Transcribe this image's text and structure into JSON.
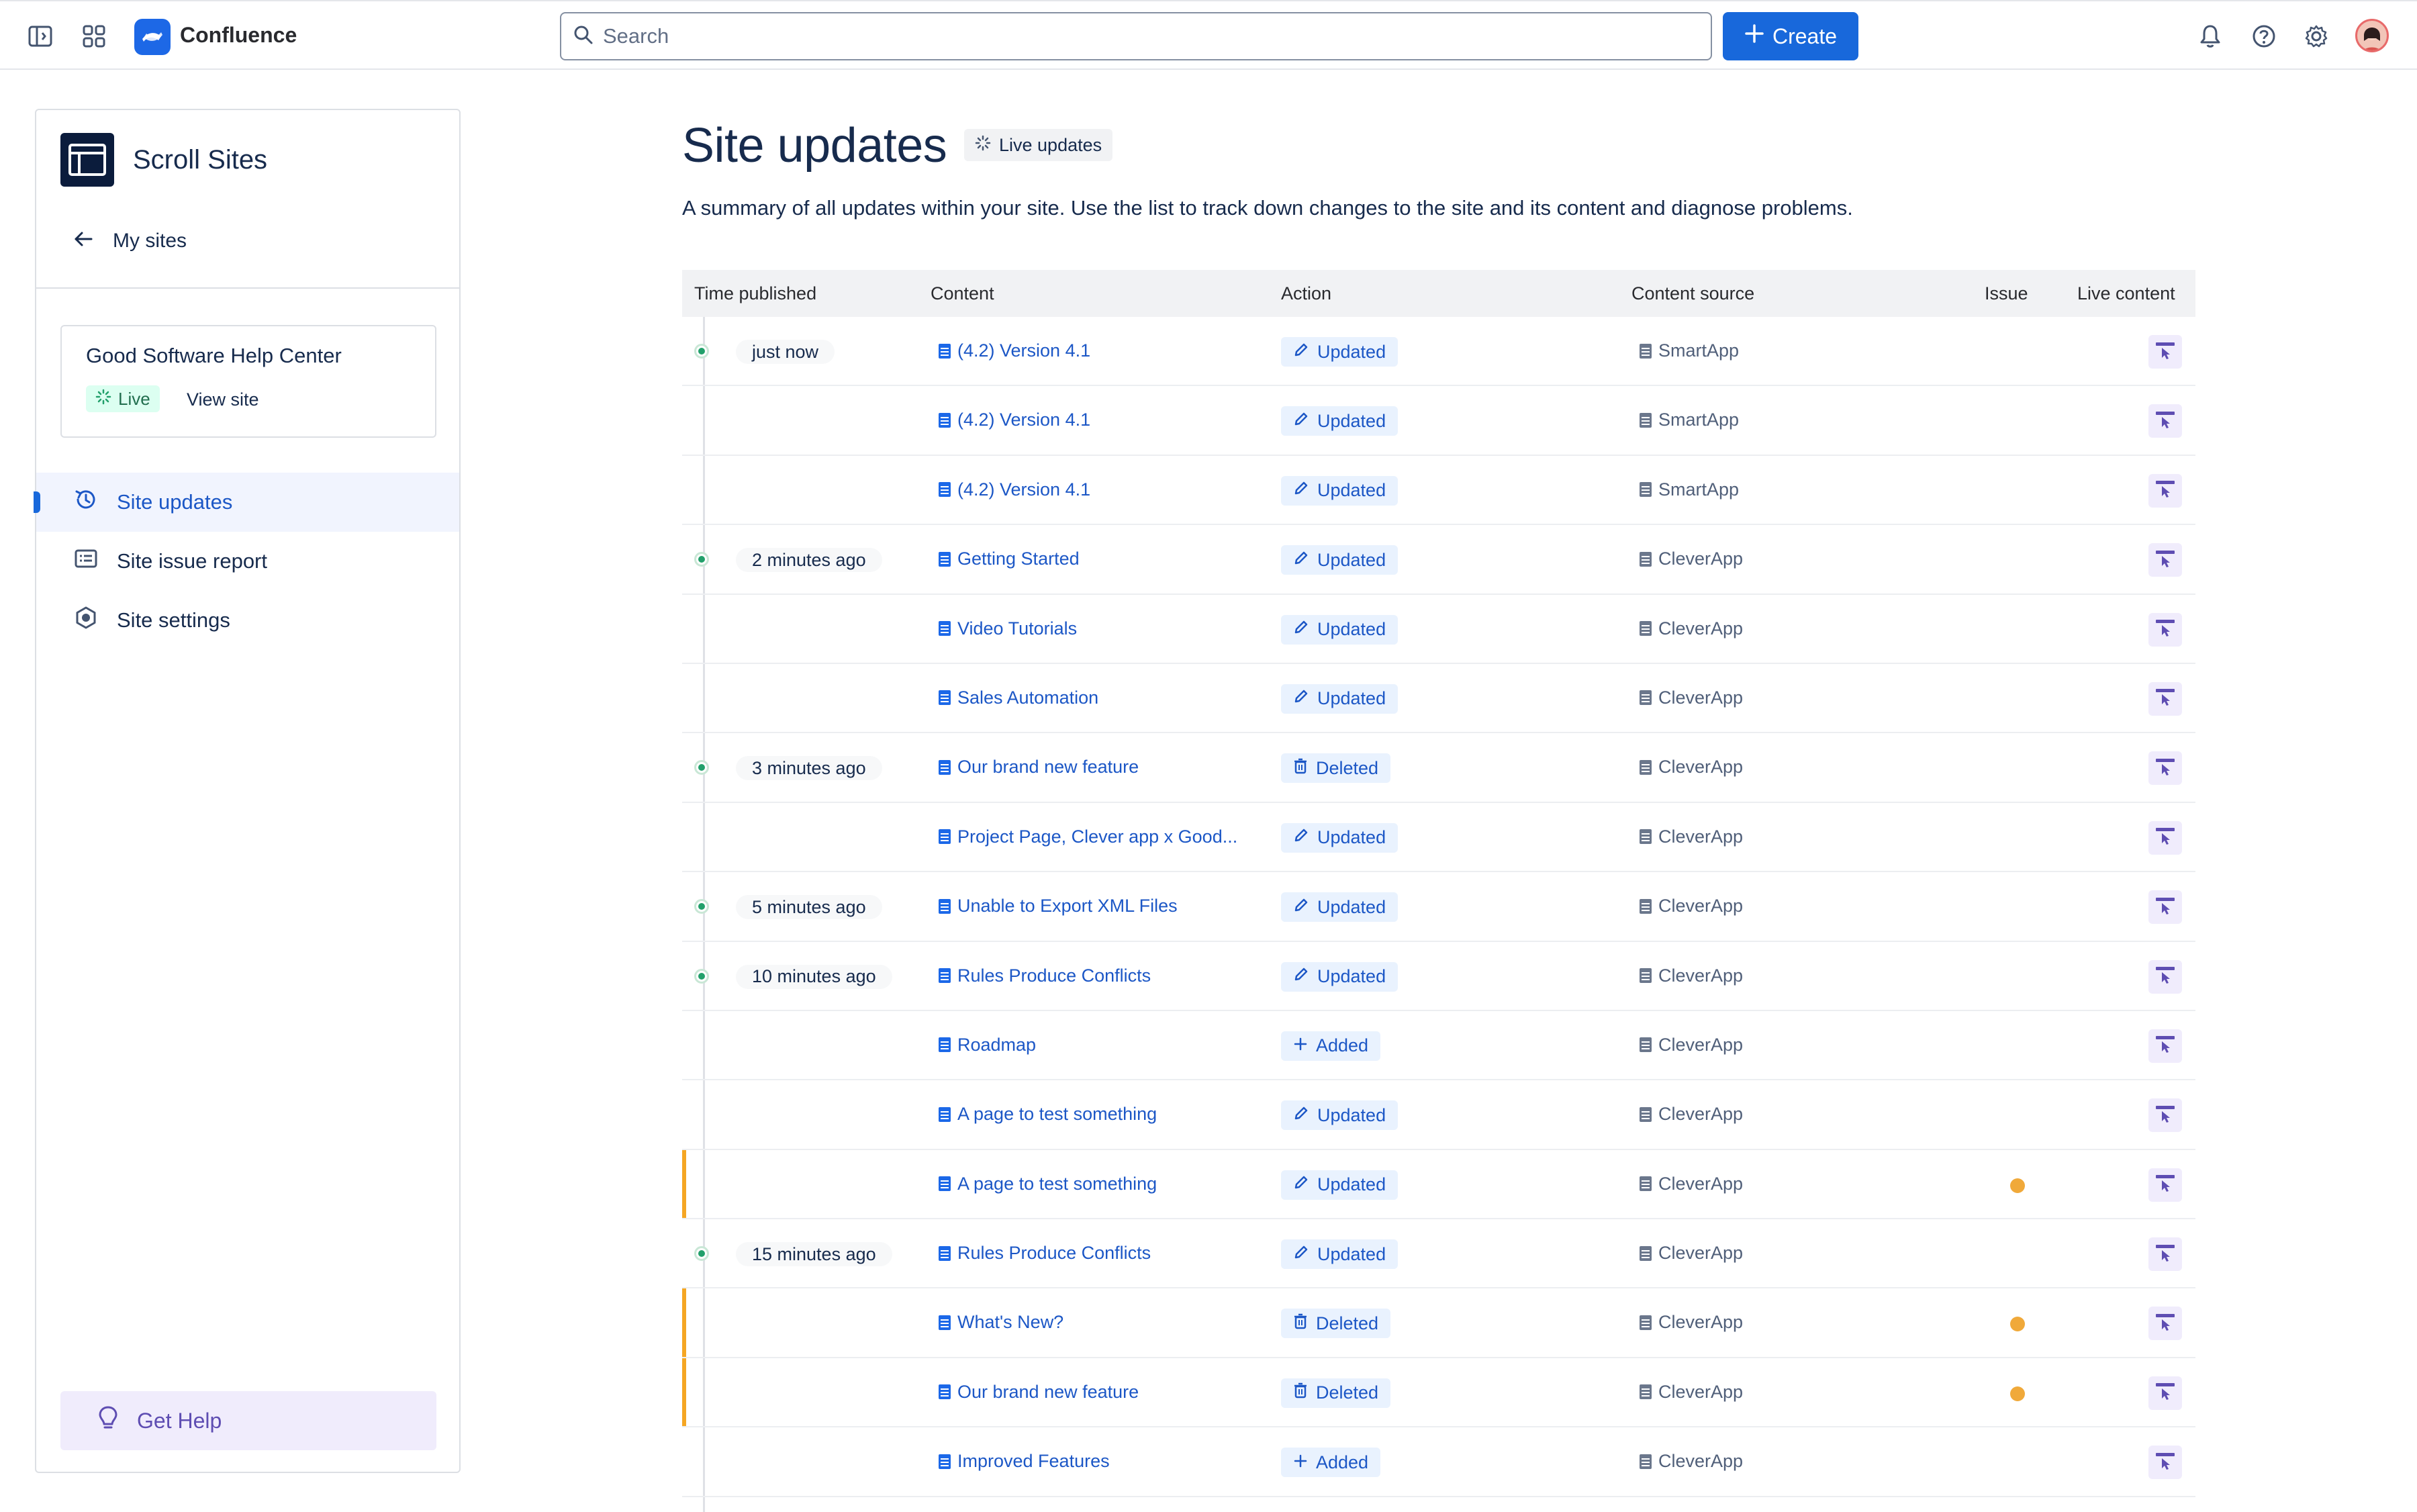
{
  "topnav": {
    "brand": "Confluence",
    "search_placeholder": "Search",
    "create_label": "Create",
    "icons": [
      "sidebar-toggle-icon",
      "app-switcher-icon",
      "confluence-logo-icon",
      "search-icon",
      "plus-icon",
      "bell-icon",
      "help-icon",
      "gear-icon"
    ]
  },
  "sidebar": {
    "app_name": "Scroll Sites",
    "back_label": "My sites",
    "site_card": {
      "name": "Good Software Help Center",
      "status": "Live",
      "view_site": "View site"
    },
    "nav": [
      {
        "label": "Site updates",
        "icon": "history-icon",
        "active": true
      },
      {
        "label": "Site issue report",
        "icon": "report-icon",
        "active": false
      },
      {
        "label": "Site settings",
        "icon": "settings-hex-icon",
        "active": false
      }
    ],
    "get_help": "Get Help"
  },
  "main": {
    "title": "Site updates",
    "live_badge": "Live updates",
    "description": "A summary of all updates within your site. Use the list to track down changes to the site and its content and diagnose problems.",
    "columns": [
      "Time published",
      "Content",
      "Action",
      "Content source",
      "Issue",
      "Live content"
    ],
    "rows": [
      {
        "time": "just now",
        "content": "(4.2) Version 4.1",
        "action": "Updated",
        "source": "SmartApp",
        "issue": false
      },
      {
        "time": "",
        "content": "(4.2) Version 4.1",
        "action": "Updated",
        "source": "SmartApp",
        "issue": false
      },
      {
        "time": "",
        "content": "(4.2) Version 4.1",
        "action": "Updated",
        "source": "SmartApp",
        "issue": false
      },
      {
        "time": "2 minutes ago",
        "content": "Getting Started",
        "action": "Updated",
        "source": "CleverApp",
        "issue": false
      },
      {
        "time": "",
        "content": "Video Tutorials",
        "action": "Updated",
        "source": "CleverApp",
        "issue": false
      },
      {
        "time": "",
        "content": "Sales Automation",
        "action": "Updated",
        "source": "CleverApp",
        "issue": false
      },
      {
        "time": "3 minutes ago",
        "content": "Our brand new feature",
        "action": "Deleted",
        "source": "CleverApp",
        "issue": false
      },
      {
        "time": "",
        "content": "Project Page, Clever app x Good...",
        "action": "Updated",
        "source": "CleverApp",
        "issue": false
      },
      {
        "time": "5 minutes ago",
        "content": "Unable to Export XML Files",
        "action": "Updated",
        "source": "CleverApp",
        "issue": false
      },
      {
        "time": "10 minutes ago",
        "content": "Rules Produce Conflicts",
        "action": "Updated",
        "source": "CleverApp",
        "issue": false
      },
      {
        "time": "",
        "content": "Roadmap",
        "action": "Added",
        "source": "CleverApp",
        "issue": false
      },
      {
        "time": "",
        "content": "A page to test something",
        "action": "Updated",
        "source": "CleverApp",
        "issue": false
      },
      {
        "time": "",
        "content": "A page to test something",
        "action": "Updated",
        "source": "CleverApp",
        "issue": true
      },
      {
        "time": "15 minutes ago",
        "content": "Rules Produce Conflicts",
        "action": "Updated",
        "source": "CleverApp",
        "issue": false
      },
      {
        "time": "",
        "content": "What's New?",
        "action": "Deleted",
        "source": "CleverApp",
        "issue": true
      },
      {
        "time": "",
        "content": "Our brand new feature",
        "action": "Deleted",
        "source": "CleverApp",
        "issue": true
      },
      {
        "time": "",
        "content": "Improved Features",
        "action": "Added",
        "source": "CleverApp",
        "issue": false
      }
    ]
  },
  "colors": {
    "accent": "#1868db",
    "link": "#1c57c6",
    "live_green": "#22a06b",
    "issue_orange": "#f0a93a",
    "help_purple": "#5e4db2"
  }
}
